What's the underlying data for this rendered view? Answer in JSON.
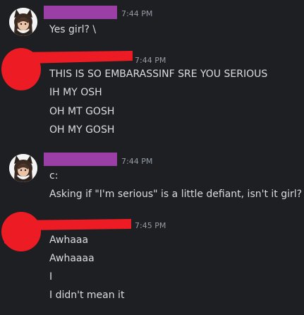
{
  "colors": {
    "background": "#1e1f22",
    "text": "#dbdee1",
    "timestamp": "#949ba4",
    "redaction_purple": "#9b3fa6",
    "redaction_red": "#ed1c24"
  },
  "messages": [
    {
      "avatar_icon": "cat-girl-avatar-icon",
      "timestamp": "7:44 PM",
      "lines": [
        "Yes girl? \\"
      ]
    },
    {
      "avatar_icon": "red-scribble-avatar-icon",
      "timestamp": "7:44 PM",
      "lines": [
        "THIS IS SO EMBARASSINF SRE YOU SERIOUS",
        "IH MY OSH",
        "OH MT GOSH",
        "OH MY GOSH"
      ]
    },
    {
      "avatar_icon": "cat-girl-avatar-icon",
      "timestamp": "7:44 PM",
      "lines": [
        "c:",
        "Asking if \"I'm serious\" is a little defiant, isn't it girl? \\"
      ]
    },
    {
      "avatar_icon": "red-scribble-avatar-icon",
      "timestamp": "7:45 PM",
      "lines": [
        "Awhaaa",
        "Awhaaaa",
        "I",
        "I didn't mean it"
      ]
    }
  ]
}
